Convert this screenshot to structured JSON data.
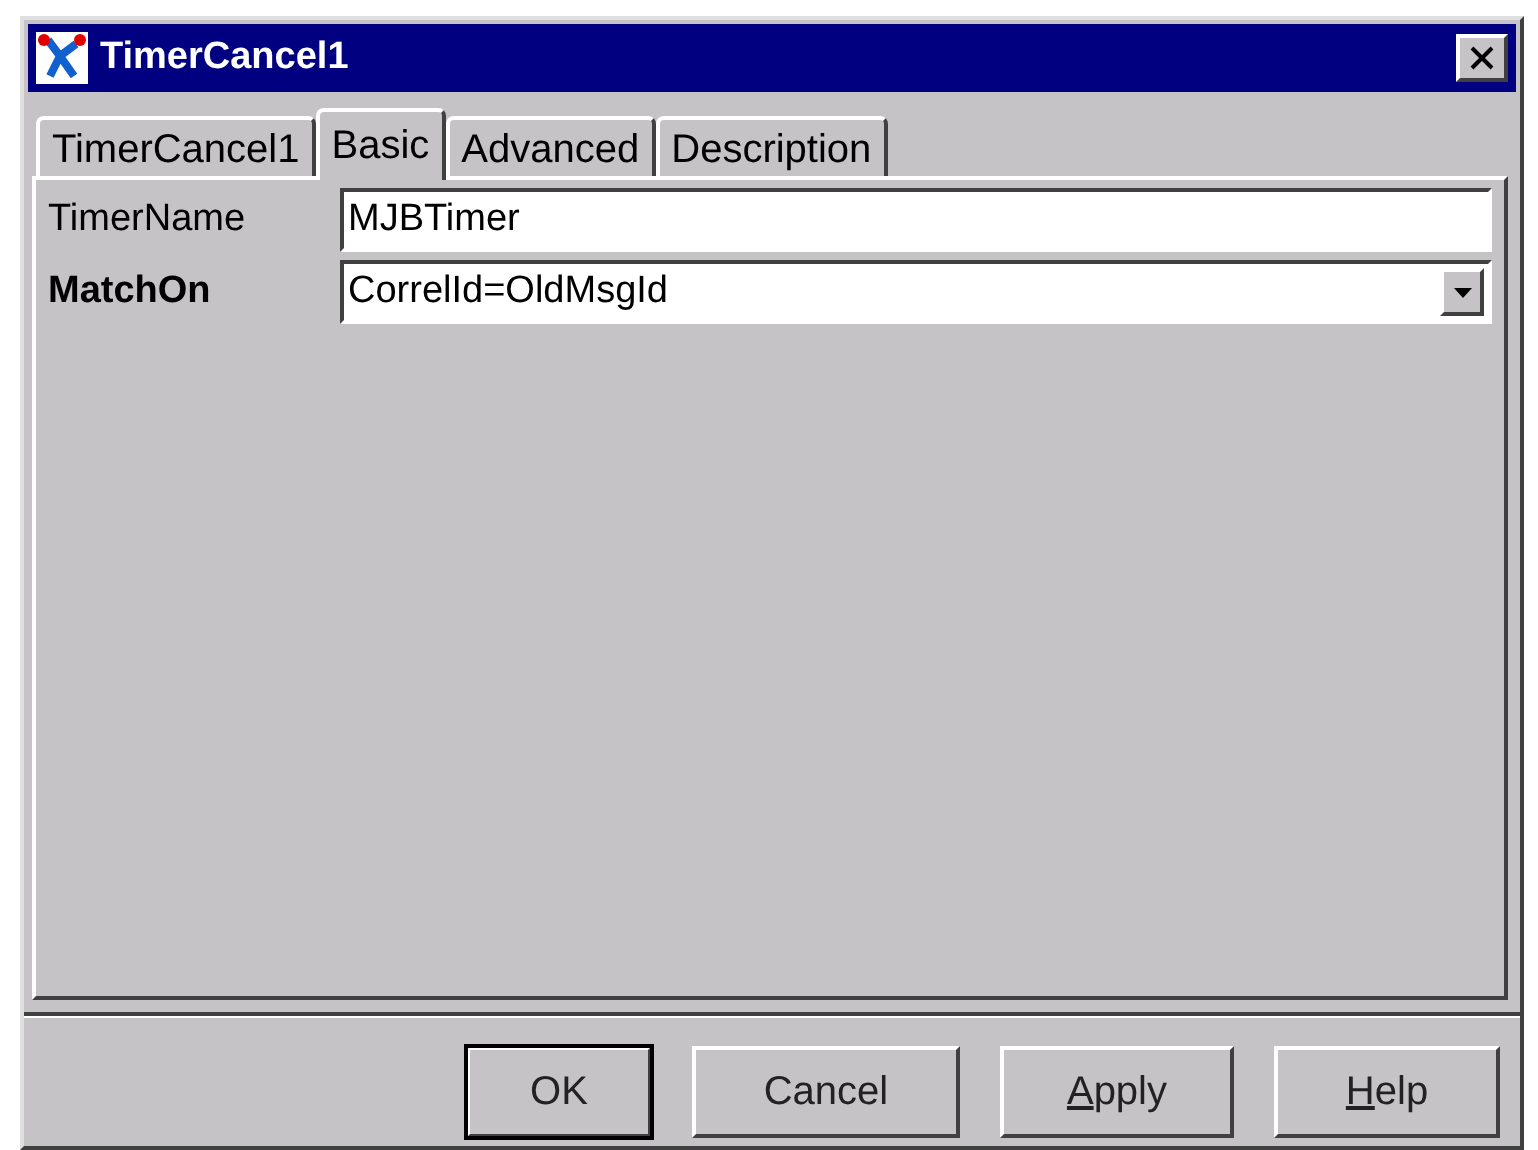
{
  "window": {
    "title": "TimerCancel1"
  },
  "tabs": [
    {
      "label": "TimerCancel1",
      "selected": false
    },
    {
      "label": "Basic",
      "selected": true
    },
    {
      "label": "Advanced",
      "selected": false
    },
    {
      "label": "Description",
      "selected": false
    }
  ],
  "fields": [
    {
      "label": "TimerName",
      "required": false,
      "kind": "text",
      "value": "MJBTimer"
    },
    {
      "label": "MatchOn",
      "required": true,
      "kind": "dropdown",
      "value": "CorrelId=OldMsgId"
    }
  ],
  "buttons": [
    {
      "label": "OK",
      "default": true,
      "first_letter_underlined": false
    },
    {
      "label": "Cancel",
      "default": false,
      "first_letter_underlined": false
    },
    {
      "label": "Apply",
      "default": false,
      "first_letter_underlined": true
    },
    {
      "label": "Help",
      "default": false,
      "first_letter_underlined": true
    }
  ]
}
